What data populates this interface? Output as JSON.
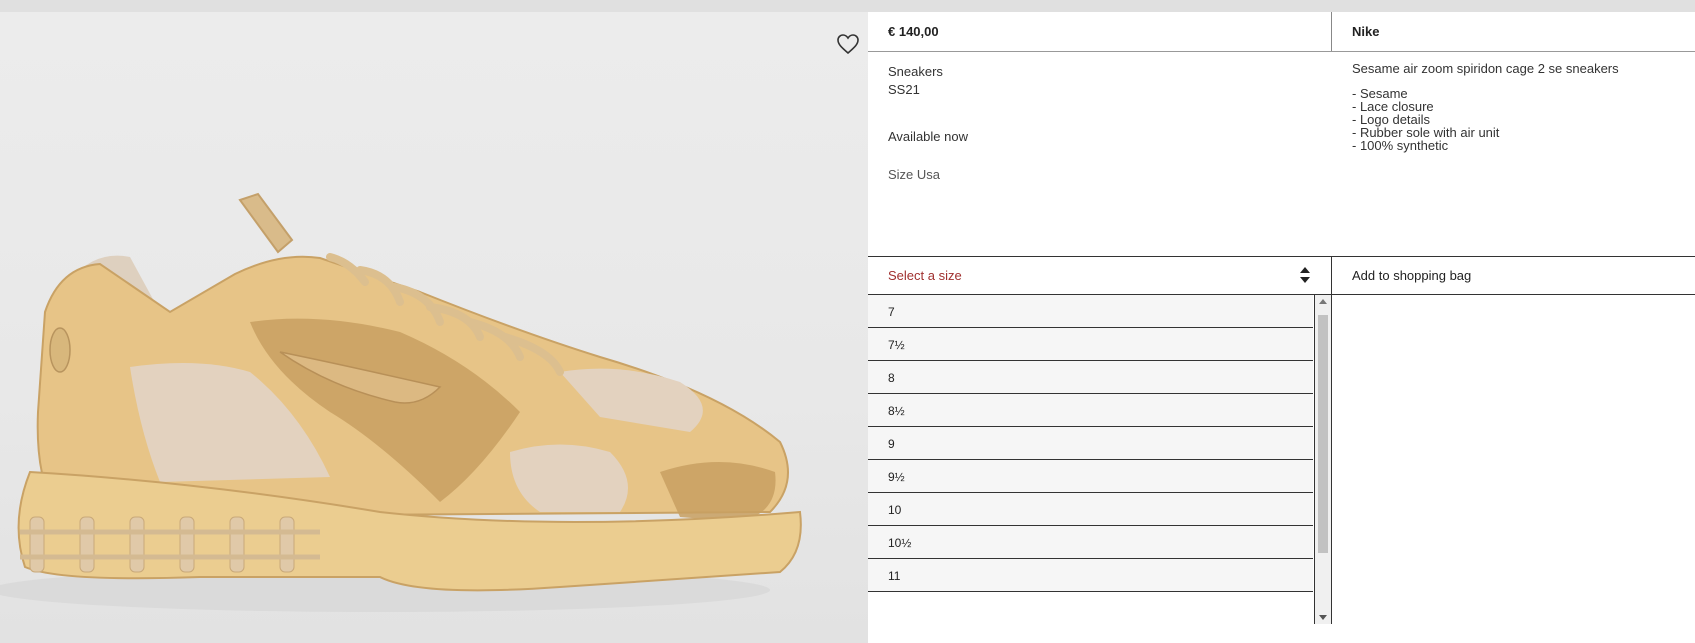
{
  "product": {
    "price": "€ 140,00",
    "brand": "Nike",
    "category": "Sneakers",
    "season": "SS21",
    "availability": "Available now",
    "size_system": "Size Usa",
    "name": "Sesame air zoom spiridon cage 2 se sneakers",
    "features": [
      "- Sesame",
      "- Lace closure",
      "- Logo details",
      "- Rubber sole with air unit",
      "- 100% synthetic"
    ],
    "image_colors": {
      "upper": "#e7c487",
      "mesh": "#d4ad6c",
      "suede": "#e3d2bf",
      "sole": "#ebcd90"
    }
  },
  "size_select": {
    "label": "Select a size",
    "icon": "sort-arrows-icon",
    "options": [
      "7",
      "7½",
      "8",
      "8½",
      "9",
      "9½",
      "10",
      "10½",
      "11"
    ]
  },
  "actions": {
    "add_to_bag": "Add to shopping bag",
    "wishlist_icon": "heart-icon"
  }
}
